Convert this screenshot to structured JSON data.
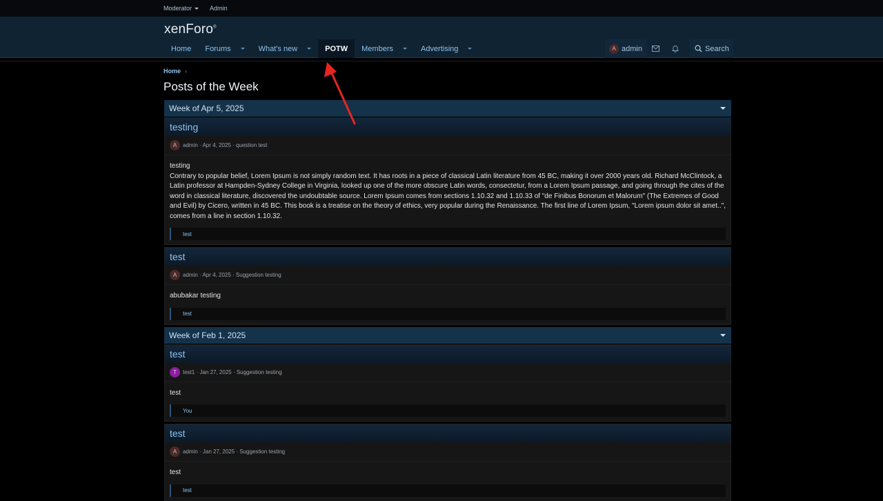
{
  "staffbar": {
    "moderator": "Moderator",
    "admin": "Admin"
  },
  "header": {
    "logo": "xenForo",
    "logo_mark": "®"
  },
  "nav": {
    "home": "Home",
    "forums": "Forums",
    "whats_new": "What's new",
    "potw": "POTW",
    "members": "Members",
    "advertising": "Advertising"
  },
  "user_nav": {
    "avatar_letter": "A",
    "username": "admin",
    "search": "Search"
  },
  "breadcrumb": {
    "home": "Home",
    "separator": "›"
  },
  "page": {
    "title": "Posts of the Week"
  },
  "weeks": [
    {
      "header": "Week of Apr 5, 2025",
      "posts": [
        {
          "title": "testing",
          "avatar": "A",
          "meta": "admin · Apr 4, 2025 · question test",
          "body_first": "testing",
          "body": "Contrary to popular belief, Lorem Ipsum is not simply random text. It has roots in a piece of classical Latin literature from 45 BC, making it over 2000 years old. Richard McClintock, a Latin professor at Hampden-Sydney College in Virginia, looked up one of the more obscure Latin words, consectetur, from a Lorem Ipsum passage, and going through the cites of the word in classical literature, discovered the undoubtable source. Lorem Ipsum comes from sections 1.10.32 and 1.10.33 of \"de Finibus Bonorum et Malorum\" (The Extremes of Good and Evil) by Cicero, written in 45 BC. This book is a treatise on the theory of ethics, very popular during the Renaissance. The first line of Lorem Ipsum, \"Lorem ipsum dolor sit amet..\", comes from a line in section 1.10.32.",
          "tag": "test"
        },
        {
          "title": "test",
          "avatar": "A",
          "meta": "admin · Apr 4, 2025 · Suggestion testing",
          "body_first": "abubakar testing",
          "tag": "test"
        }
      ]
    },
    {
      "header": "Week of Feb 1, 2025",
      "posts": [
        {
          "title": "test",
          "avatar": "T",
          "meta": "test1 · Jan 27, 2025 · Suggestion testing",
          "body_first": "test",
          "tag": "You"
        },
        {
          "title": "test",
          "avatar": "A",
          "meta": "admin · Jan 27, 2025 · Suggestion testing",
          "body_first": "test",
          "tag": "test"
        }
      ]
    }
  ],
  "colors": {
    "accent": "#8fc3ee",
    "header_bg": "#0f2332",
    "week_bg": "#14324a",
    "annotation": "#e8261f"
  }
}
